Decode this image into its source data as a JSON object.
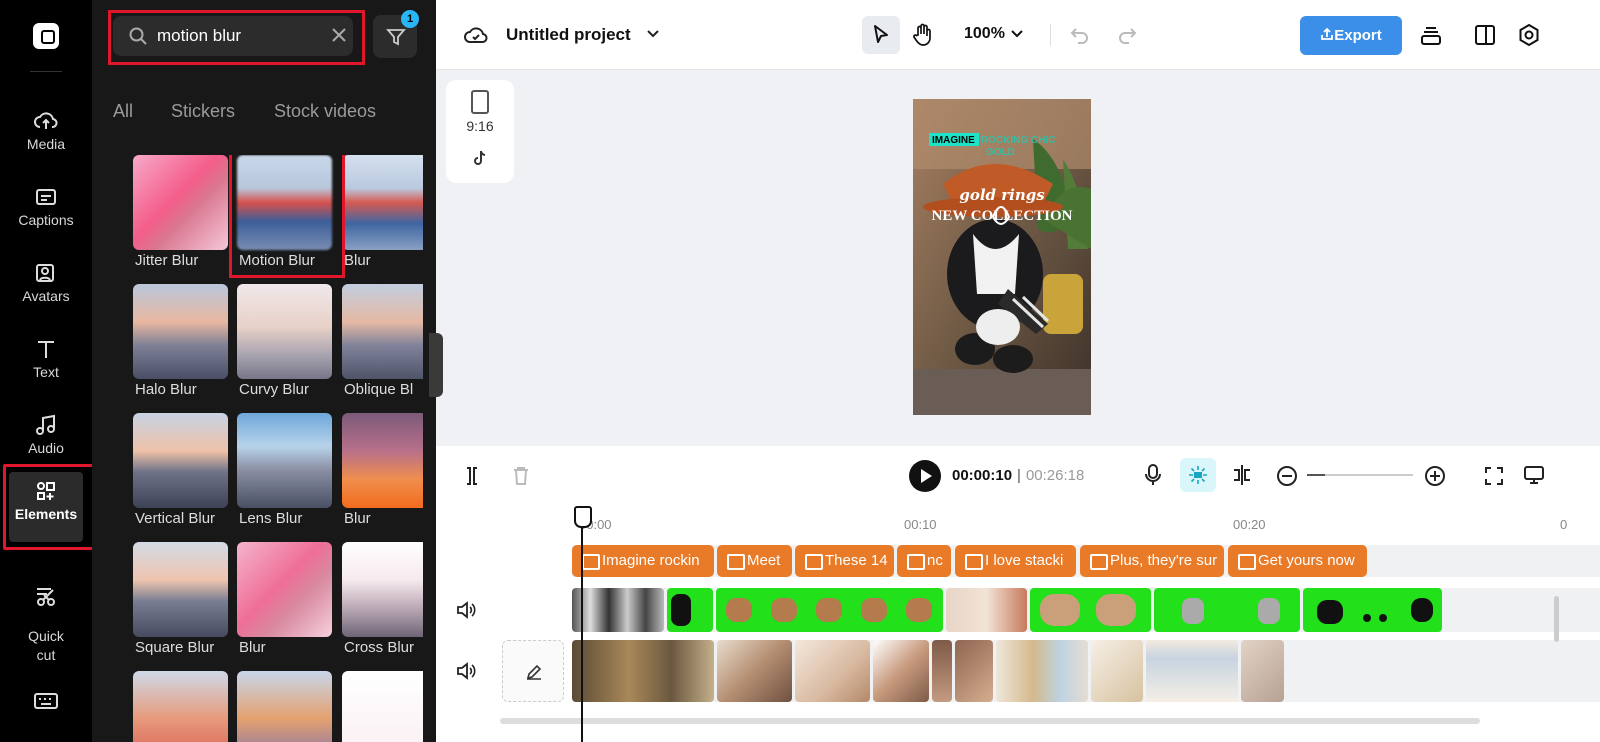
{
  "sidebar": {
    "items": [
      {
        "label": "Media"
      },
      {
        "label": "Captions"
      },
      {
        "label": "Avatars"
      },
      {
        "label": "Text"
      },
      {
        "label": "Audio"
      },
      {
        "label": "Elements"
      },
      {
        "label": "Quick\ncut"
      }
    ],
    "active": "Elements"
  },
  "panel": {
    "search_value": "motion blur",
    "filter_badge": "1",
    "tabs": [
      "All",
      "Stickers",
      "Stock videos"
    ],
    "results": [
      {
        "label": "Jitter Blur"
      },
      {
        "label": "Motion Blur",
        "selected": true
      },
      {
        "label": "Blur"
      },
      {
        "label": "Halo Blur"
      },
      {
        "label": "Curvy Blur"
      },
      {
        "label": "Oblique Bl"
      },
      {
        "label": "Vertical Blur"
      },
      {
        "label": "Lens Blur"
      },
      {
        "label": "Blur"
      },
      {
        "label": "Square Blur"
      },
      {
        "label": "Blur"
      },
      {
        "label": "Cross Blur"
      }
    ]
  },
  "header": {
    "project_title": "Untitled project",
    "zoom": "100%",
    "export_label": "Export"
  },
  "canvas": {
    "ratio_label": "9:16",
    "video_text": {
      "line1_highlight": "IMAGINE",
      "line1_rest": "ROCKING CHIC",
      "line2": "GOLD",
      "script": "gold rings",
      "headline": "NEW COLLECTION"
    }
  },
  "timeline": {
    "current_time": "00:00:10",
    "separator": "|",
    "duration": "00:26:18",
    "ruler_ticks": [
      "00:00",
      "00:10",
      "00:20",
      "0"
    ],
    "captions": [
      "Imagine rockin",
      "Meet",
      "These 14",
      "nc",
      "I love stacki",
      "Plus, they're sur",
      "Get yours now"
    ]
  },
  "colors": {
    "accent": "#3b8fe8",
    "caption_clip": "#e97a27",
    "greenscreen": "#22e01a",
    "highlight_box": "#e0162b"
  }
}
